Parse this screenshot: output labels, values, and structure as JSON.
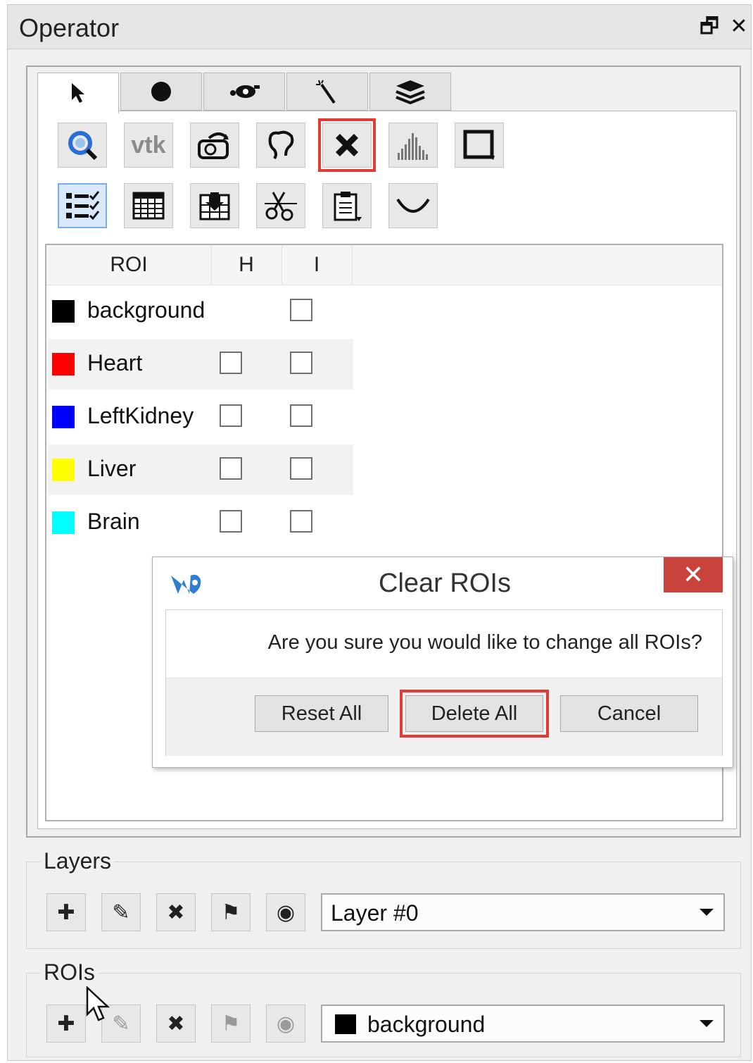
{
  "window": {
    "title": "Operator",
    "restore_label": "🗗",
    "close_label": "✕"
  },
  "tabs": [
    {
      "icon": "pointer-icon",
      "active": true
    },
    {
      "icon": "circle-icon"
    },
    {
      "icon": "eye-drop-icon"
    },
    {
      "icon": "magic-wand-icon"
    },
    {
      "icon": "layers-stack-icon"
    }
  ],
  "toolbar_row1": [
    "search-roi-icon",
    "vtk-icon",
    "rotate-camera-icon",
    "lasso-icon",
    "clear-x-icon",
    "histogram-icon",
    "rectangle-icon"
  ],
  "toolbar_row2": [
    "checklist-icon",
    "grid-table-icon",
    "import-icon",
    "scissors-icon",
    "clipboard-paste-icon",
    "curve-icon"
  ],
  "vtk_label": "vtk",
  "roi_table": {
    "headers": [
      "ROI",
      "H",
      "I"
    ],
    "rows": [
      {
        "name": "background",
        "color": "#000000",
        "has_h": false
      },
      {
        "name": "Heart",
        "color": "#ff0000",
        "has_h": true
      },
      {
        "name": "LeftKidney",
        "color": "#0000ff",
        "has_h": true
      },
      {
        "name": "Liver",
        "color": "#ffff00",
        "has_h": true
      },
      {
        "name": "Brain",
        "color": "#00ffff",
        "has_h": true
      }
    ]
  },
  "dialog": {
    "title": "Clear ROIs",
    "close_label": "✕",
    "message": "Are you sure you would like to change all ROIs?",
    "buttons": {
      "reset": "Reset All",
      "delete": "Delete All",
      "cancel": "Cancel"
    }
  },
  "layers": {
    "label": "Layers",
    "buttons": [
      {
        "icon": "add-icon",
        "glyph": "✚"
      },
      {
        "icon": "edit-pencil-icon",
        "glyph": "✎"
      },
      {
        "icon": "delete-icon",
        "glyph": "✖"
      },
      {
        "icon": "brush-icon",
        "glyph": "⚑"
      },
      {
        "icon": "eye-icon",
        "glyph": "◉"
      }
    ],
    "selected": "Layer #0"
  },
  "rois": {
    "label": "ROIs",
    "buttons": [
      {
        "icon": "add-icon",
        "glyph": "✚"
      },
      {
        "icon": "edit-pencil-icon",
        "glyph": "✎"
      },
      {
        "icon": "delete-icon",
        "glyph": "✖"
      },
      {
        "icon": "brush-icon",
        "glyph": "⚑"
      },
      {
        "icon": "eye-icon",
        "glyph": "◉"
      }
    ],
    "selected": "background",
    "selected_color": "#000000"
  },
  "colors": {
    "highlight": "#e53935",
    "dialog_close": "#c9423c",
    "selected_tool": "#d9e8fb"
  }
}
